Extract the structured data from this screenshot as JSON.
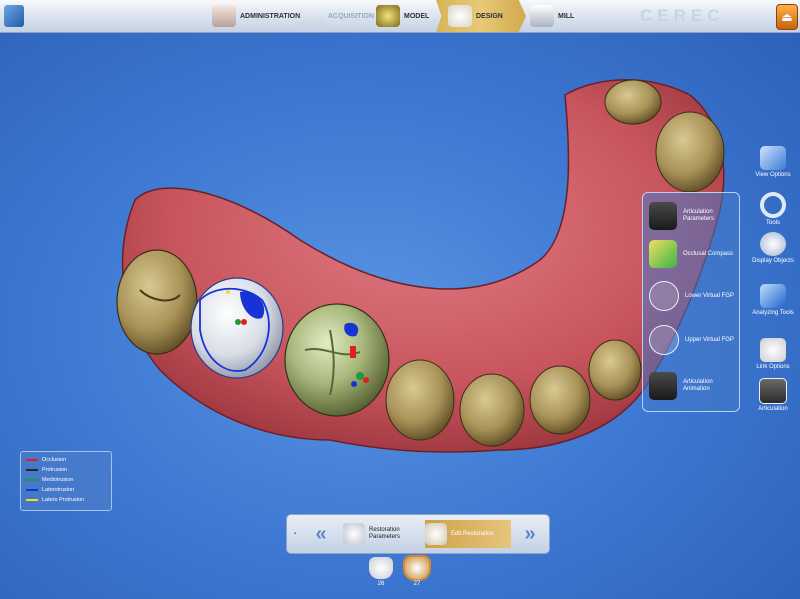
{
  "app": {
    "brand": "CEREC",
    "exit_icon": "exit-door-icon"
  },
  "phases": [
    {
      "label": "ADMINISTRATION",
      "icon": "administration-icon",
      "state": "normal"
    },
    {
      "label": "ACQUISITION",
      "icon": "acquisition-camera-icon",
      "state": "disabled"
    },
    {
      "label": "MODEL",
      "icon": "model-icon",
      "state": "normal"
    },
    {
      "label": "DESIGN",
      "icon": "design-tooth-icon",
      "state": "active"
    },
    {
      "label": "MILL",
      "icon": "mill-machine-icon",
      "state": "normal"
    }
  ],
  "sidebar": {
    "items": [
      {
        "label": "View Options",
        "icon": "view-cube-icon"
      },
      {
        "label": "Tools",
        "icon": "tools-ring-icon"
      },
      {
        "label": "Display Objects",
        "icon": "display-objects-icon"
      },
      {
        "label": "Analyzing Tools",
        "icon": "analyzing-tools-icon"
      },
      {
        "label": "Link Options",
        "icon": "link-tooth-icon"
      },
      {
        "label": "Articulation",
        "icon": "articulation-icon"
      }
    ]
  },
  "flyout": {
    "items": [
      {
        "label": "Articulation Parameters",
        "icon": "articulator-icon"
      },
      {
        "label": "Occlusal Compass",
        "icon": "occlusal-compass-icon"
      },
      {
        "label": "Lower Virtual FGP",
        "icon": "lower-fgp-icon"
      },
      {
        "label": "Upper Virtual FGP",
        "icon": "upper-fgp-icon"
      },
      {
        "label": "Articulation Animation",
        "icon": "animation-icon"
      }
    ]
  },
  "legend": {
    "items": [
      {
        "label": "Occlusion",
        "color": "#e02020"
      },
      {
        "label": "Protrusion",
        "color": "#1d2a2a"
      },
      {
        "label": "Mediotrusion",
        "color": "#1f9a3a"
      },
      {
        "label": "Laterotrusion",
        "color": "#1733d6"
      },
      {
        "label": "Latero Protrusion",
        "color": "#e8e020"
      }
    ]
  },
  "wizard": {
    "back_label": "«",
    "forward_label": "»",
    "steps": [
      {
        "label": "Restoration Parameters",
        "icon": "crown-parameters-icon",
        "state": "normal"
      },
      {
        "label": "Edit Restoration",
        "icon": "edit-crown-icon",
        "state": "active"
      }
    ]
  },
  "teeth": [
    {
      "label": "26",
      "icon": "tooth-26-icon",
      "selected": false
    },
    {
      "label": "27",
      "icon": "tooth-27-icon",
      "selected": true
    }
  ]
}
